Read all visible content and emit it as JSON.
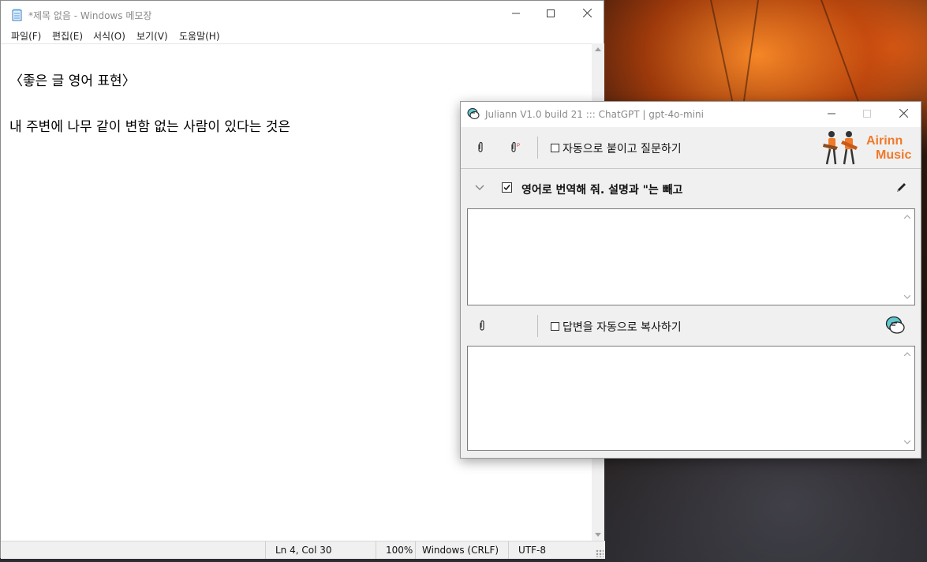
{
  "notepad": {
    "title": "*제목 없음 - Windows 메모장",
    "menu": [
      "파일(F)",
      "편집(E)",
      "서식(O)",
      "보기(V)",
      "도움말(H)"
    ],
    "lines": [
      "〈좋은 글 영어 표현〉",
      "",
      "내 주변에 나무 같이 변함 없는 사람이 있다는 것은"
    ],
    "status": {
      "position": "Ln 4, Col 30",
      "zoom": "100%",
      "line_ending": "Windows (CRLF)",
      "encoding": "UTF-8"
    }
  },
  "juliann": {
    "title": "Juliann V1.0 build 21 ::: ChatGPT | gpt-4o-mini",
    "auto_paste_label": "자동으로 붙이고 질문하기",
    "auto_paste_checked": false,
    "logo": {
      "line1": "Airinn",
      "line2": "Music"
    },
    "prompt_checked": true,
    "prompt_text": "영어로 번역해 줘. 설명과 \"는 빼고",
    "question_text": "",
    "auto_copy_label": "답변을 자동으로 복사하기",
    "auto_copy_checked": false,
    "answer_text": ""
  },
  "colors": {
    "accent": "#f07a2a",
    "chat_icon": "#5fc9cf"
  }
}
